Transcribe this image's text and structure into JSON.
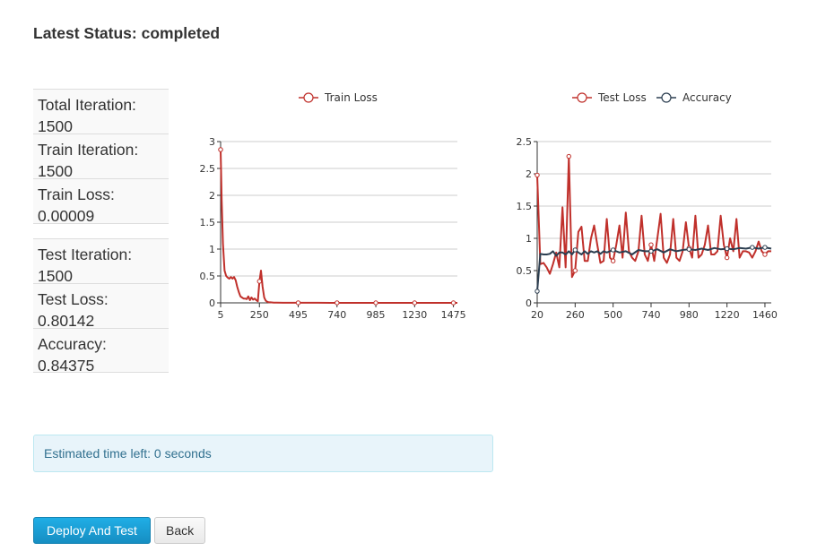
{
  "status": {
    "label": "Latest Status:",
    "value": "completed"
  },
  "stats": [
    {
      "label": "Total Iteration:",
      "value": "1500"
    },
    {
      "label": "Train Iteration:",
      "value": "1500"
    },
    {
      "label": "Train Loss:",
      "value": "0.00009"
    },
    {
      "label": "Test Iteration:",
      "value": "1500"
    },
    {
      "label": "Test Loss:",
      "value": "0.80142"
    },
    {
      "label": "Accuracy:",
      "value": "0.84375"
    }
  ],
  "alert": {
    "text": "Estimated time left: 0 seconds"
  },
  "buttons": {
    "deploy": "Deploy And Test",
    "back": "Back"
  },
  "colors": {
    "loss": "#c0302b",
    "accuracy": "#2c3e50",
    "grid": "#cccccc",
    "primary": "#1aa0d8"
  },
  "chart_data": [
    {
      "type": "line",
      "legend_position": "top",
      "grid": true,
      "x_ticks": [
        5,
        250,
        495,
        740,
        985,
        1230,
        1475
      ],
      "y_ticks": [
        0,
        0.5,
        1,
        1.5,
        2,
        2.5,
        3
      ],
      "y_tick_labels": [
        "0",
        "0.5",
        "1",
        "1.5",
        "2",
        "2.5",
        "3"
      ],
      "xlim": [
        5,
        1500
      ],
      "ylim": [
        0,
        3
      ],
      "series": [
        {
          "name": "Train Loss",
          "color": "#c0302b",
          "x": [
            5,
            12,
            20,
            30,
            40,
            50,
            60,
            70,
            80,
            90,
            100,
            110,
            120,
            130,
            140,
            150,
            160,
            170,
            180,
            190,
            200,
            210,
            220,
            230,
            240,
            250,
            260,
            270,
            280,
            290,
            300,
            310,
            320,
            340,
            360,
            400,
            450,
            495,
            550,
            620,
            700,
            740,
            820,
            900,
            985,
            1100,
            1230,
            1350,
            1475,
            1500
          ],
          "y": [
            2.85,
            1.9,
            1.1,
            0.6,
            0.5,
            0.47,
            0.45,
            0.48,
            0.45,
            0.48,
            0.42,
            0.3,
            0.2,
            0.12,
            0.1,
            0.08,
            0.08,
            0.07,
            0.12,
            0.05,
            0.1,
            0.06,
            0.08,
            0.05,
            0.03,
            0.4,
            0.6,
            0.3,
            0.1,
            0.04,
            0.02,
            0.01,
            0.01,
            0.005,
            0.003,
            0.002,
            0.002,
            0.001,
            0.001,
            0.001,
            0.0005,
            0.0005,
            0.0004,
            0.0003,
            0.0003,
            0.0002,
            0.0001,
            0.0001,
            0.0001,
            9e-05
          ]
        }
      ]
    },
    {
      "type": "line",
      "legend_position": "top",
      "grid": true,
      "x_ticks": [
        20,
        260,
        500,
        740,
        980,
        1220,
        1460
      ],
      "y_ticks": [
        0,
        0.5,
        1,
        1.5,
        2,
        2.5
      ],
      "y_tick_labels": [
        "0",
        "0.5",
        "1",
        "1.5",
        "2",
        "2.5"
      ],
      "xlim": [
        20,
        1500
      ],
      "ylim": [
        0,
        2.5
      ],
      "series": [
        {
          "name": "Test Loss",
          "color": "#c0302b",
          "x": [
            20,
            40,
            60,
            80,
            100,
            120,
            140,
            160,
            180,
            200,
            220,
            240,
            260,
            280,
            300,
            320,
            340,
            360,
            380,
            400,
            420,
            440,
            460,
            480,
            500,
            520,
            540,
            560,
            580,
            600,
            620,
            640,
            660,
            680,
            700,
            720,
            740,
            760,
            780,
            800,
            820,
            840,
            860,
            880,
            900,
            920,
            940,
            960,
            980,
            1000,
            1020,
            1040,
            1060,
            1080,
            1100,
            1120,
            1140,
            1160,
            1180,
            1200,
            1220,
            1240,
            1260,
            1280,
            1300,
            1320,
            1340,
            1360,
            1380,
            1400,
            1420,
            1440,
            1460,
            1480,
            1500
          ],
          "y": [
            1.98,
            0.6,
            0.62,
            0.55,
            0.45,
            0.6,
            0.78,
            0.55,
            1.48,
            0.55,
            2.27,
            0.4,
            0.5,
            1.1,
            1.18,
            0.65,
            0.65,
            1.0,
            1.2,
            0.9,
            0.62,
            0.65,
            1.3,
            0.7,
            0.65,
            0.9,
            1.2,
            0.7,
            1.4,
            0.8,
            0.7,
            0.65,
            0.8,
            1.35,
            0.75,
            0.65,
            0.9,
            0.65,
            1.0,
            1.38,
            0.7,
            0.62,
            0.75,
            1.3,
            0.7,
            0.65,
            0.8,
            1.25,
            0.85,
            0.7,
            1.35,
            0.7,
            0.75,
            0.9,
            1.2,
            0.75,
            0.75,
            0.8,
            1.35,
            0.9,
            0.7,
            1.0,
            0.8,
            1.3,
            0.7,
            0.8,
            0.8,
            0.78,
            0.7,
            0.8,
            0.95,
            0.8,
            0.75,
            0.8,
            0.8
          ]
        },
        {
          "name": "Accuracy",
          "color": "#2c3e50",
          "x": [
            20,
            40,
            60,
            80,
            100,
            120,
            140,
            160,
            180,
            200,
            220,
            240,
            260,
            280,
            300,
            320,
            340,
            360,
            380,
            400,
            420,
            440,
            460,
            480,
            500,
            540,
            580,
            620,
            660,
            700,
            740,
            780,
            820,
            860,
            900,
            940,
            980,
            1020,
            1060,
            1100,
            1140,
            1180,
            1220,
            1260,
            1300,
            1340,
            1380,
            1420,
            1460,
            1500
          ],
          "y": [
            0.18,
            0.76,
            0.75,
            0.75,
            0.76,
            0.8,
            0.73,
            0.78,
            0.78,
            0.75,
            0.8,
            0.75,
            0.82,
            0.78,
            0.75,
            0.8,
            0.76,
            0.8,
            0.78,
            0.8,
            0.76,
            0.8,
            0.78,
            0.8,
            0.82,
            0.78,
            0.8,
            0.75,
            0.82,
            0.8,
            0.8,
            0.83,
            0.78,
            0.83,
            0.8,
            0.82,
            0.83,
            0.82,
            0.84,
            0.82,
            0.85,
            0.83,
            0.84,
            0.83,
            0.85,
            0.84,
            0.86,
            0.84,
            0.86,
            0.84
          ]
        }
      ]
    }
  ]
}
